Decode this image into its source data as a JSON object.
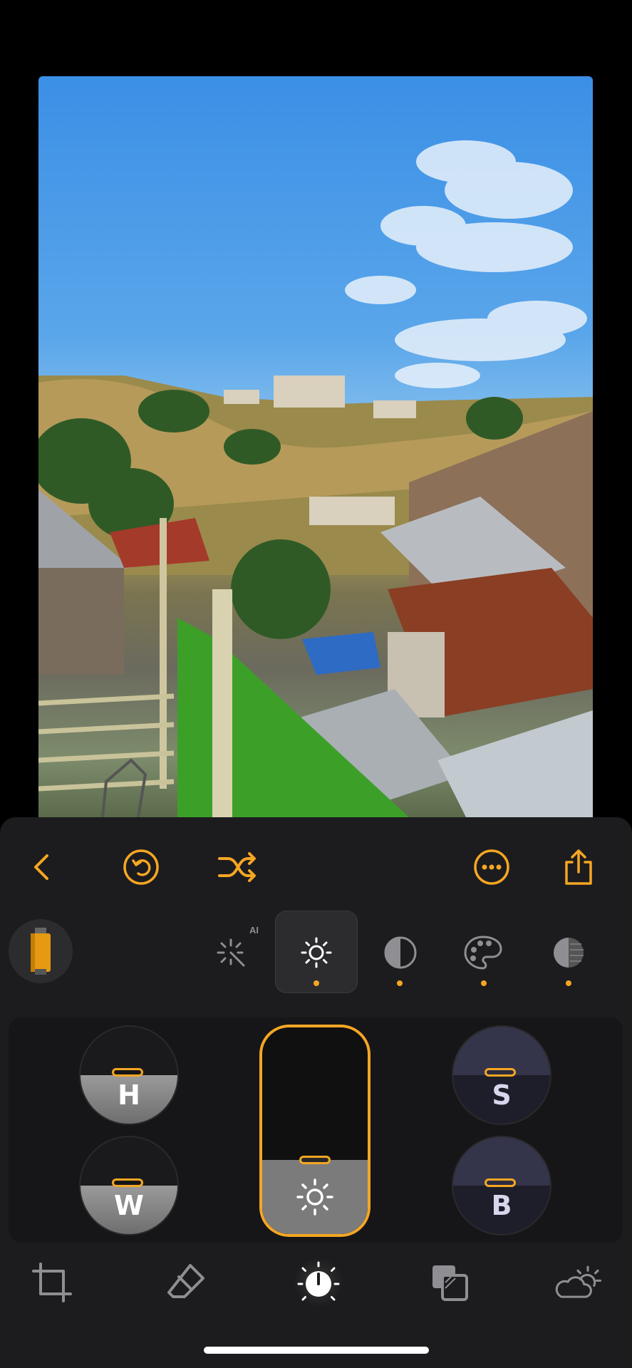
{
  "photo": {
    "description_icon": "photo-landscape"
  },
  "toolbar": {
    "back": "chevron-left-icon",
    "undo": "undo-icon",
    "shuffle": "shuffle-icon",
    "more": "more-icon",
    "share": "share-icon"
  },
  "tools": {
    "film": "film-icon",
    "ai_label": "AI",
    "items": [
      "magic-wand-icon",
      "brightness-icon",
      "contrast-icon",
      "palette-icon",
      "vignette-icon"
    ],
    "selected": 1
  },
  "controls": {
    "h_label": "H",
    "w_label": "W",
    "s_label": "S",
    "b_label": "B",
    "main_slider_level": 0.36
  },
  "bottom_nav": [
    "crop-icon",
    "eraser-icon",
    "adjust-icon",
    "layers-icon",
    "weather-icon"
  ],
  "colors": {
    "accent": "#f5a623",
    "panel": "#1c1c1e"
  }
}
